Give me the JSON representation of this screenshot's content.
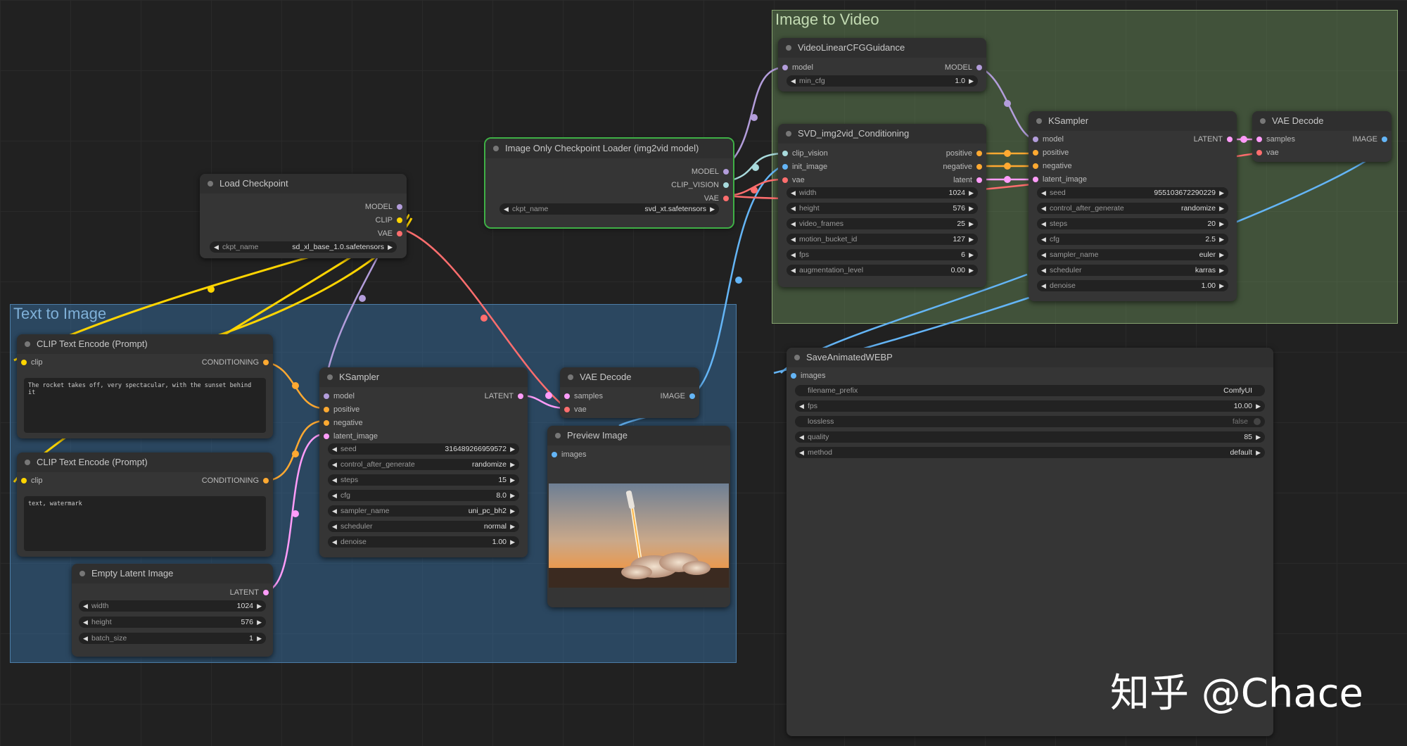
{
  "colors": {
    "model": "#b39ddb",
    "clip": "#ffd500",
    "vae": "#ff6e6e",
    "conditioning": "#ffa931",
    "latent": "#ff9cf9",
    "image": "#64b5f6",
    "clip_vision": "#a8dadc"
  },
  "groups": {
    "t2i": "Text to Image",
    "i2v": "Image to Video"
  },
  "load_checkpoint": {
    "title": "Load Checkpoint",
    "out_model": "MODEL",
    "out_clip": "CLIP",
    "out_vae": "VAE",
    "ckpt_label": "ckpt_name",
    "ckpt_value": "sd_xl_base_1.0.safetensors"
  },
  "img_ckpt": {
    "title": "Image Only Checkpoint Loader (img2vid model)",
    "out_model": "MODEL",
    "out_clip_vision": "CLIP_VISION",
    "out_vae": "VAE",
    "ckpt_label": "ckpt_name",
    "ckpt_value": "svd_xt.safetensors"
  },
  "clip1": {
    "title": "CLIP Text Encode (Prompt)",
    "in_clip": "clip",
    "out": "CONDITIONING",
    "text": "The rocket takes off, very spectacular, with the sunset behind it"
  },
  "clip2": {
    "title": "CLIP Text Encode (Prompt)",
    "in_clip": "clip",
    "out": "CONDITIONING",
    "text": "text, watermark"
  },
  "empty_latent": {
    "title": "Empty Latent Image",
    "out": "LATENT",
    "w": [
      {
        "k": "width",
        "v": "1024"
      },
      {
        "k": "height",
        "v": "576"
      },
      {
        "k": "batch_size",
        "v": "1"
      }
    ]
  },
  "ksampler1": {
    "title": "KSampler",
    "in": [
      "model",
      "positive",
      "negative",
      "latent_image"
    ],
    "out": "LATENT",
    "w": [
      {
        "k": "seed",
        "v": "316489266959572"
      },
      {
        "k": "control_after_generate",
        "v": "randomize"
      },
      {
        "k": "steps",
        "v": "15"
      },
      {
        "k": "cfg",
        "v": "8.0"
      },
      {
        "k": "sampler_name",
        "v": "uni_pc_bh2"
      },
      {
        "k": "scheduler",
        "v": "normal"
      },
      {
        "k": "denoise",
        "v": "1.00"
      }
    ]
  },
  "vae_decode1": {
    "title": "VAE Decode",
    "in": [
      "samples",
      "vae"
    ],
    "out": "IMAGE"
  },
  "preview": {
    "title": "Preview Image",
    "in": "images"
  },
  "video_cfg": {
    "title": "VideoLinearCFGGuidance",
    "in": "model",
    "out": "MODEL",
    "w": [
      {
        "k": "min_cfg",
        "v": "1.0"
      }
    ]
  },
  "svd_cond": {
    "title": "SVD_img2vid_Conditioning",
    "in": [
      "clip_vision",
      "init_image",
      "vae"
    ],
    "out": [
      "positive",
      "negative",
      "latent"
    ],
    "w": [
      {
        "k": "width",
        "v": "1024"
      },
      {
        "k": "height",
        "v": "576"
      },
      {
        "k": "video_frames",
        "v": "25"
      },
      {
        "k": "motion_bucket_id",
        "v": "127"
      },
      {
        "k": "fps",
        "v": "6"
      },
      {
        "k": "augmentation_level",
        "v": "0.00"
      }
    ]
  },
  "ksampler2": {
    "title": "KSampler",
    "in": [
      "model",
      "positive",
      "negative",
      "latent_image"
    ],
    "out": "LATENT",
    "w": [
      {
        "k": "seed",
        "v": "955103672290229"
      },
      {
        "k": "control_after_generate",
        "v": "randomize"
      },
      {
        "k": "steps",
        "v": "20"
      },
      {
        "k": "cfg",
        "v": "2.5"
      },
      {
        "k": "sampler_name",
        "v": "euler"
      },
      {
        "k": "scheduler",
        "v": "karras"
      },
      {
        "k": "denoise",
        "v": "1.00"
      }
    ]
  },
  "vae_decode2": {
    "title": "VAE Decode",
    "in": [
      "samples",
      "vae"
    ],
    "out": "IMAGE"
  },
  "save_webp": {
    "title": "SaveAnimatedWEBP",
    "in": "images",
    "w": [
      {
        "k": "filename_prefix",
        "v": "ComfyUI"
      },
      {
        "k": "fps",
        "v": "10.00"
      },
      {
        "k": "lossless",
        "v": "false"
      },
      {
        "k": "quality",
        "v": "85"
      },
      {
        "k": "method",
        "v": "default"
      }
    ]
  },
  "watermark": "知乎 @Chace"
}
